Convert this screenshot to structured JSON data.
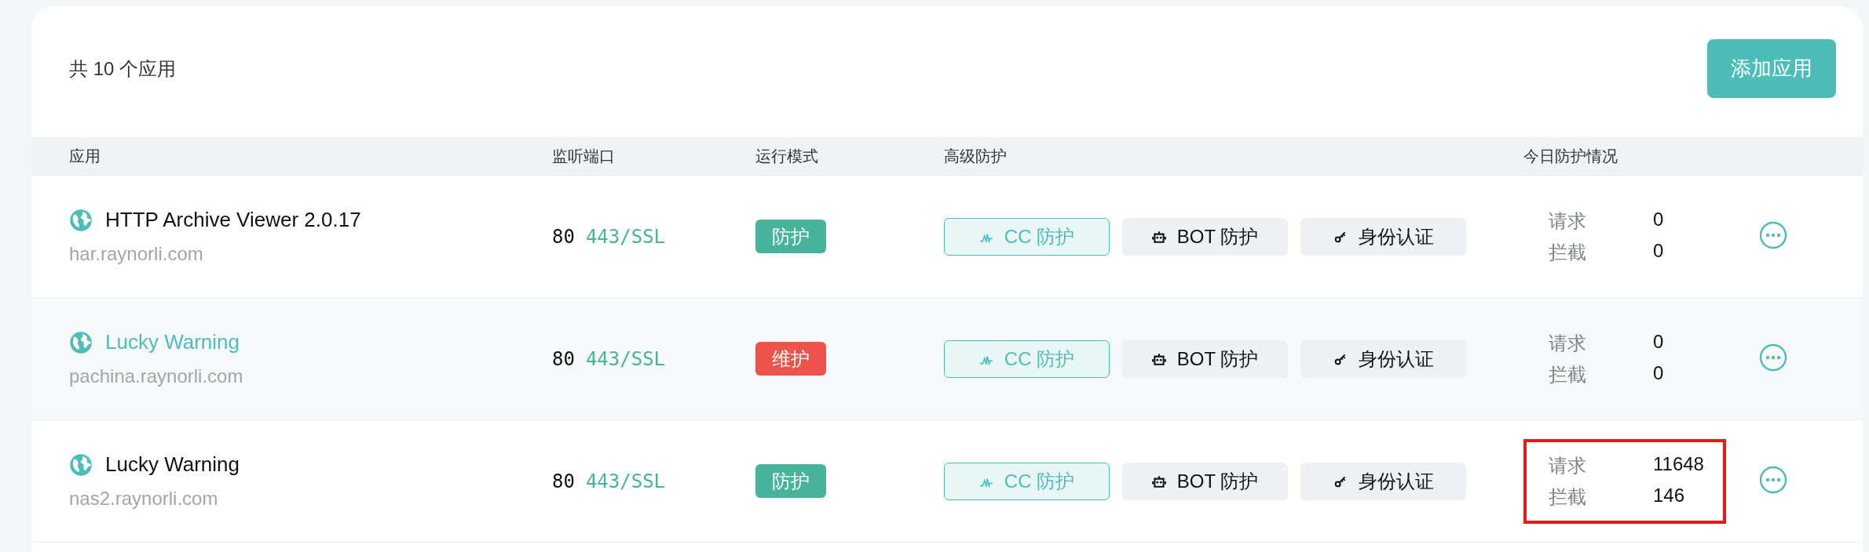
{
  "summary": "共 10 个应用",
  "add_button": "添加应用",
  "columns": [
    "应用",
    "监听端口",
    "运行模式",
    "高级防护",
    "今日防护情况"
  ],
  "rows": [
    {
      "name": "HTTP Archive Viewer 2.0.17",
      "domain": "har.raynorli.com",
      "highlighted": false,
      "ports": [
        "80",
        "443/SSL"
      ],
      "mode": {
        "label": "防护",
        "color": "#45b49a"
      },
      "features": [
        {
          "kind": "cc",
          "label": "CC 防护",
          "on": true
        },
        {
          "kind": "bot",
          "label": "BOT 防护",
          "on": false
        },
        {
          "kind": "auth",
          "label": "身份认证",
          "on": false
        }
      ],
      "stats": [
        {
          "label": "请求",
          "value": "0"
        },
        {
          "label": "拦截",
          "value": "0"
        }
      ],
      "annotated": false
    },
    {
      "name": "Lucky Warning",
      "domain": "pachina.raynorli.com",
      "highlighted": true,
      "ports": [
        "80",
        "443/SSL"
      ],
      "mode": {
        "label": "维护",
        "color": "#ee534b"
      },
      "features": [
        {
          "kind": "cc",
          "label": "CC 防护",
          "on": true
        },
        {
          "kind": "bot",
          "label": "BOT 防护",
          "on": false
        },
        {
          "kind": "auth",
          "label": "身份认证",
          "on": false
        }
      ],
      "stats": [
        {
          "label": "请求",
          "value": "0"
        },
        {
          "label": "拦截",
          "value": "0"
        }
      ],
      "annotated": false
    },
    {
      "name": "Lucky Warning",
      "domain": "nas2.raynorli.com",
      "highlighted": false,
      "ports": [
        "80",
        "443/SSL"
      ],
      "mode": {
        "label": "防护",
        "color": "#45b49a"
      },
      "features": [
        {
          "kind": "cc",
          "label": "CC 防护",
          "on": true
        },
        {
          "kind": "bot",
          "label": "BOT 防护",
          "on": false
        },
        {
          "kind": "auth",
          "label": "身份认证",
          "on": false
        }
      ],
      "stats": [
        {
          "label": "请求",
          "value": "11648"
        },
        {
          "label": "拦截",
          "value": "146"
        }
      ],
      "annotated": true
    }
  ]
}
